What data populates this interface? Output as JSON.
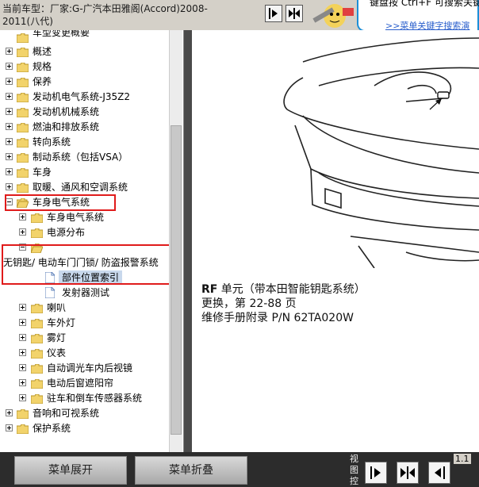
{
  "header": {
    "car_model": "当前车型：厂家:G-广汽本田雅阁(Accord)2008-2011(八代)",
    "tip_text": "键盘按 Ctrl+F 可搜索关键字！",
    "tip_link": ">>菜单关键字搜索演"
  },
  "tree": {
    "items": [
      {
        "label": "车型变更概要"
      },
      {
        "label": "概述"
      },
      {
        "label": "规格"
      },
      {
        "label": "保养"
      },
      {
        "label": "发动机电气系统-J35Z2"
      },
      {
        "label": "发动机机械系统"
      },
      {
        "label": "燃油和排放系统"
      },
      {
        "label": "转向系统"
      },
      {
        "label": "制动系统（包括VSA）"
      },
      {
        "label": "车身"
      },
      {
        "label": "取暖、通风和空调系统"
      },
      {
        "label": "车身电气系统"
      },
      {
        "label": "车身电气系统"
      },
      {
        "label": "电源分布"
      },
      {
        "label": "无钥匙/ 电动车门门锁/ 防盗报警系统"
      },
      {
        "label": "部件位置索引"
      },
      {
        "label": "发射器测试"
      },
      {
        "label": "喇叭"
      },
      {
        "label": "车外灯"
      },
      {
        "label": "雾灯"
      },
      {
        "label": "仪表"
      },
      {
        "label": "自动调光车内后视镜"
      },
      {
        "label": "电动后窗遮阳帘"
      },
      {
        "label": "驻车和倒车传感器系统"
      },
      {
        "label": "音响和可视系统"
      },
      {
        "label": "保护系统"
      }
    ]
  },
  "content": {
    "line1_prefix": "RF",
    "line1_rest": " 单元（带本田智能钥匙系统）",
    "line2": "更换，第 22-88 页",
    "line3": "维修手册附录 P/N 62TA020W"
  },
  "footer": {
    "expand_label": "菜单展开",
    "collapse_label": "菜单折叠",
    "view_label": "视图控",
    "version": "1.1"
  },
  "colors": {
    "highlight": "#e01b1b",
    "folder": "#f2d36b",
    "tip_border": "#1c8fd8"
  }
}
